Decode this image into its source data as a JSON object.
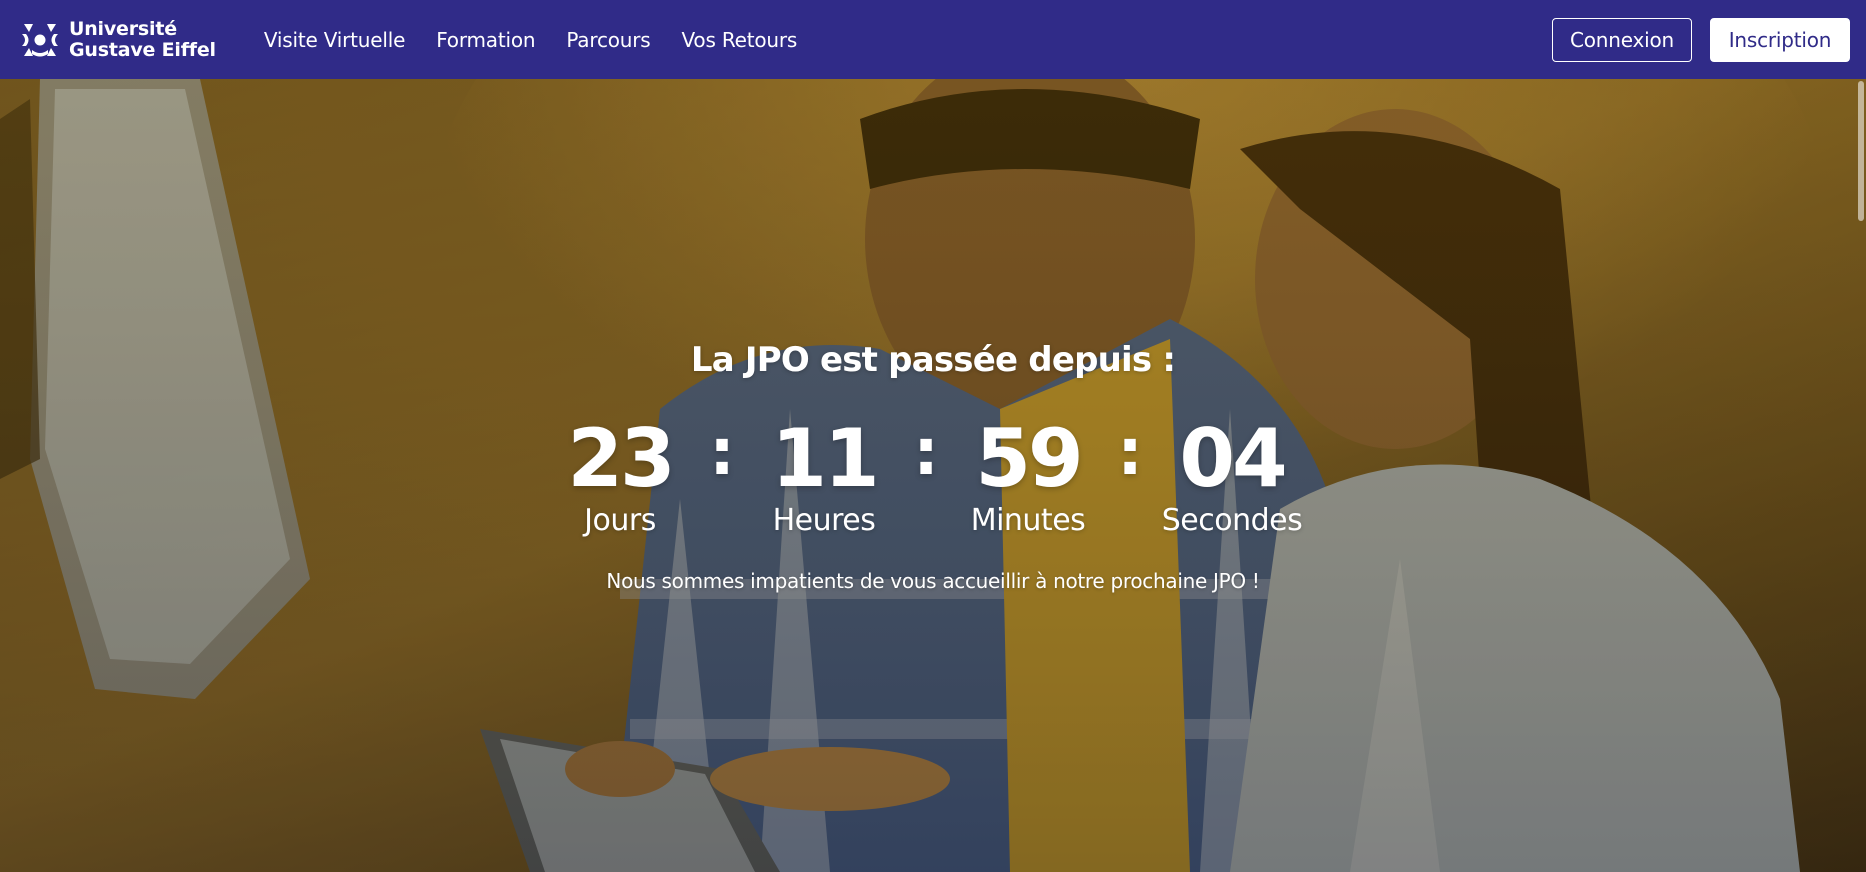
{
  "brand": {
    "line1": "Université",
    "line2": "Gustave Eiffel",
    "nav_bg": "#302b88"
  },
  "nav": {
    "links": [
      "Visite Virtuelle",
      "Formation",
      "Parcours",
      "Vos Retours"
    ],
    "login_label": "Connexion",
    "signup_label": "Inscription"
  },
  "hero": {
    "title": "La JPO est passée depuis :",
    "countdown": [
      {
        "value": "23",
        "label": "Jours"
      },
      {
        "value": "11",
        "label": "Heures"
      },
      {
        "value": "59",
        "label": "Minutes"
      },
      {
        "value": "04",
        "label": "Secondes"
      }
    ],
    "separator": ":",
    "subtitle": "Nous sommes impatients de vous accueillir à notre prochaine JPO !",
    "overlay_color": "#b8860b"
  }
}
